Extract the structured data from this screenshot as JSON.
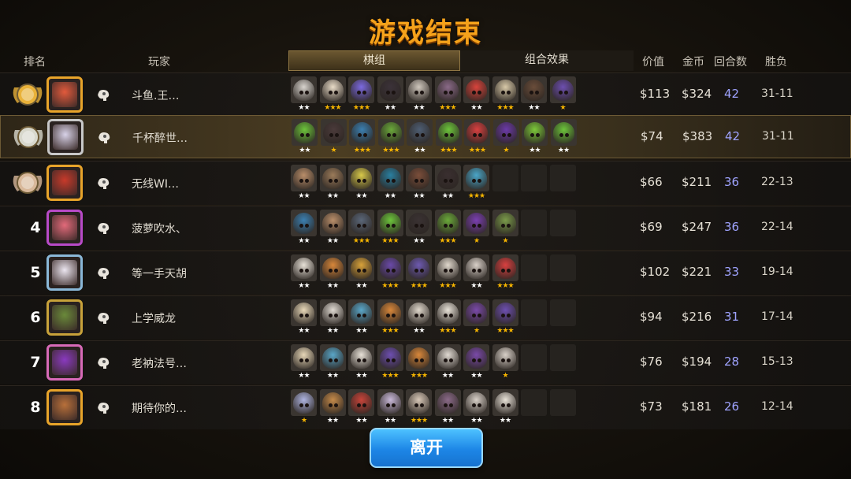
{
  "title": "游戏结束",
  "headers": {
    "rank": "排名",
    "player": "玩家",
    "value": "价值",
    "gold": "金币",
    "rounds": "回合数",
    "winloss": "胜负"
  },
  "tabs": {
    "pieces": "棋组",
    "synergy": "组合效果"
  },
  "leave_button": "离开",
  "colors": {
    "title": "#f5a21b",
    "rounds": "#9fa3ff",
    "star_gold": "#f5b400",
    "star_white": "#ffffff",
    "accent_button": "#1d86e6"
  },
  "rows": [
    {
      "rank": "",
      "medal": "gold",
      "name": "斗鱼.王…",
      "value": "$113",
      "gold": "$324",
      "rounds": "42",
      "wl": "31-11",
      "units": [
        [
          "#d8d4ce",
          2
        ],
        [
          "#e9dcc8",
          3
        ],
        [
          "#7c6ae0",
          3
        ],
        [
          "#3b3239",
          2
        ],
        [
          "#cfc7bd",
          2
        ],
        [
          "#8a6a88",
          3
        ],
        [
          "#d8443c",
          2
        ],
        [
          "#d8c9a8",
          3
        ],
        [
          "#6a4d3a",
          2
        ],
        [
          "#6d4fb0",
          1
        ]
      ]
    },
    {
      "rank": "",
      "medal": "silver",
      "name": "千杯醉世…",
      "value": "$74",
      "gold": "$383",
      "rounds": "42",
      "wl": "31-11",
      "selected": true,
      "units": [
        [
          "#6cc43b",
          2
        ],
        [
          "#4a3a3a",
          1
        ],
        [
          "#3b7fb0",
          3
        ],
        [
          "#6aa83a",
          3
        ],
        [
          "#4e5e73",
          2
        ],
        [
          "#6cc43b",
          3
        ],
        [
          "#d84040",
          3
        ],
        [
          "#6b3aa8",
          1
        ],
        [
          "#7cc83a",
          2
        ],
        [
          "#6cc43b",
          2
        ]
      ]
    },
    {
      "rank": "",
      "medal": "bronze",
      "name": "无线WI…",
      "value": "$66",
      "gold": "$211",
      "rounds": "36",
      "wl": "22-13",
      "units": [
        [
          "#b98e6a",
          2
        ],
        [
          "#9b7b5a",
          2
        ],
        [
          "#d8c94a",
          2
        ],
        [
          "#2a7fa0",
          2
        ],
        [
          "#7b4e3a",
          2
        ],
        [
          "#3a2f30",
          2
        ],
        [
          "#4aa6c8",
          3
        ],
        null,
        null,
        null
      ]
    },
    {
      "rank": "4",
      "name": "菠萝吹水、",
      "value": "$69",
      "gold": "$247",
      "rounds": "36",
      "wl": "22-14",
      "units": [
        [
          "#3b7fb0",
          2
        ],
        [
          "#b98e6a",
          2
        ],
        [
          "#5a6678",
          3
        ],
        [
          "#6cc43b",
          3
        ],
        [
          "#3a3233",
          2
        ],
        [
          "#6aa83a",
          3
        ],
        [
          "#7a3fb0",
          1
        ],
        [
          "#7a9a4a",
          1
        ],
        null,
        null
      ]
    },
    {
      "rank": "5",
      "name": "等一手天胡",
      "value": "$102",
      "gold": "$221",
      "rounds": "33",
      "wl": "19-14",
      "units": [
        [
          "#e8e2d8",
          2
        ],
        [
          "#d8873a",
          2
        ],
        [
          "#d8a23a",
          2
        ],
        [
          "#6a4aa8",
          3
        ],
        [
          "#6d5ab0",
          3
        ],
        [
          "#e0d8cc",
          3
        ],
        [
          "#d8d0c8",
          2
        ],
        [
          "#d84040",
          3
        ],
        null,
        null
      ]
    },
    {
      "rank": "6",
      "name": "上学威龙",
      "value": "$94",
      "gold": "$216",
      "rounds": "31",
      "wl": "17-14",
      "units": [
        [
          "#e8d8b8",
          2
        ],
        [
          "#e0dad2",
          2
        ],
        [
          "#5aa6c8",
          2
        ],
        [
          "#d8873a",
          3
        ],
        [
          "#e0d8cc",
          2
        ],
        [
          "#e8e2d8",
          3
        ],
        [
          "#7a4aa8",
          1
        ],
        [
          "#6d4fb0",
          3
        ],
        null,
        null
      ]
    },
    {
      "rank": "7",
      "name": "老衲法号…",
      "value": "$76",
      "gold": "$194",
      "rounds": "28",
      "wl": "15-13",
      "units": [
        [
          "#e8d8b8",
          2
        ],
        [
          "#5aa6c8",
          2
        ],
        [
          "#e8e2d8",
          2
        ],
        [
          "#6d4fb0",
          3
        ],
        [
          "#d8873a",
          3
        ],
        [
          "#e0dad2",
          2
        ],
        [
          "#7a4aa8",
          2
        ],
        [
          "#d8d0c8",
          1
        ],
        null,
        null
      ]
    },
    {
      "rank": "8",
      "name": "期待你的…",
      "value": "$73",
      "gold": "$181",
      "rounds": "26",
      "wl": "12-14",
      "units": [
        [
          "#aeb4e0",
          1
        ],
        [
          "#c48a4a",
          2
        ],
        [
          "#c8443a",
          2
        ],
        [
          "#c8b8d8",
          2
        ],
        [
          "#d8c8b8",
          3
        ],
        [
          "#8a6a88",
          2
        ],
        [
          "#d8d0c8",
          2
        ],
        [
          "#e8e2d8",
          2
        ],
        null,
        null
      ]
    }
  ]
}
